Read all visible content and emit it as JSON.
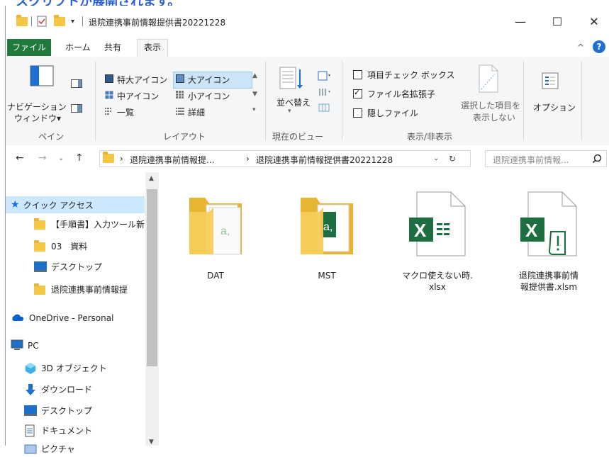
{
  "caption": "スクリプトが展開されます。",
  "window": {
    "title": "退院連携事前情報提供書20221228",
    "minimize": "—",
    "maximize": "☐",
    "close": "✕"
  },
  "tabs": {
    "file": "ファイル",
    "home": "ホーム",
    "share": "共有",
    "view": "表示",
    "collapse": "^",
    "help": "?"
  },
  "ribbon": {
    "pane_group": {
      "nav_pane_line1": "ナビゲーション",
      "nav_pane_line2": "ウィンドウ▾",
      "label": "ペイン"
    },
    "layout_group": {
      "extra_large": "特大アイコン",
      "large": "大アイコン",
      "medium": "中アイコン",
      "small": "小アイコン",
      "list": "一覧",
      "details": "詳細",
      "label": "レイアウト"
    },
    "current_view": {
      "sort_line1": "並べ替え",
      "label": "現在のビュー"
    },
    "show_hide": {
      "item_checkboxes": "項目チェック ボックス",
      "item_checkboxes_checked": false,
      "file_extensions": "ファイル名拡張子",
      "file_extensions_checked": true,
      "hidden_items": "隠しファイル",
      "hidden_items_checked": false,
      "hide_selected_line1": "選択した項目を",
      "hide_selected_line2": "表示しない",
      "label": "表示/非表示"
    },
    "options": "オプション"
  },
  "address": {
    "crumb1": "退院連携事前情報提...",
    "crumb2": "退院連携事前情報提供書20221228",
    "search_placeholder": "退院連携事前情報..."
  },
  "nav": {
    "quick_access": "クイック アクセス",
    "items": [
      "【手順書】入力ツール新",
      "03　資料",
      "デスクトップ",
      "退院連携事前情報提"
    ],
    "onedrive": "OneDrive - Personal",
    "pc": "PC",
    "pc_items": [
      "3D オブジェクト",
      "ダウンロード",
      "デスクトップ",
      "ドキュメント",
      "ピクチャ"
    ]
  },
  "files": [
    {
      "name_line1": "DAT",
      "name_line2": "",
      "type": "folder"
    },
    {
      "name_line1": "MST",
      "name_line2": "",
      "type": "folder"
    },
    {
      "name_line1": "マクロ使えない時.",
      "name_line2": "xlsx",
      "type": "xlsx"
    },
    {
      "name_line1": "退院連携事前情",
      "name_line2": "報提供書.xlsm",
      "type": "xlsm"
    }
  ],
  "colors": {
    "accent_green": "#1f7a3c",
    "excel_green": "#1d6f42",
    "folder_yellow": "#f3c744",
    "selection_blue": "#cce8ff",
    "caption_blue": "#2a5fd4"
  }
}
